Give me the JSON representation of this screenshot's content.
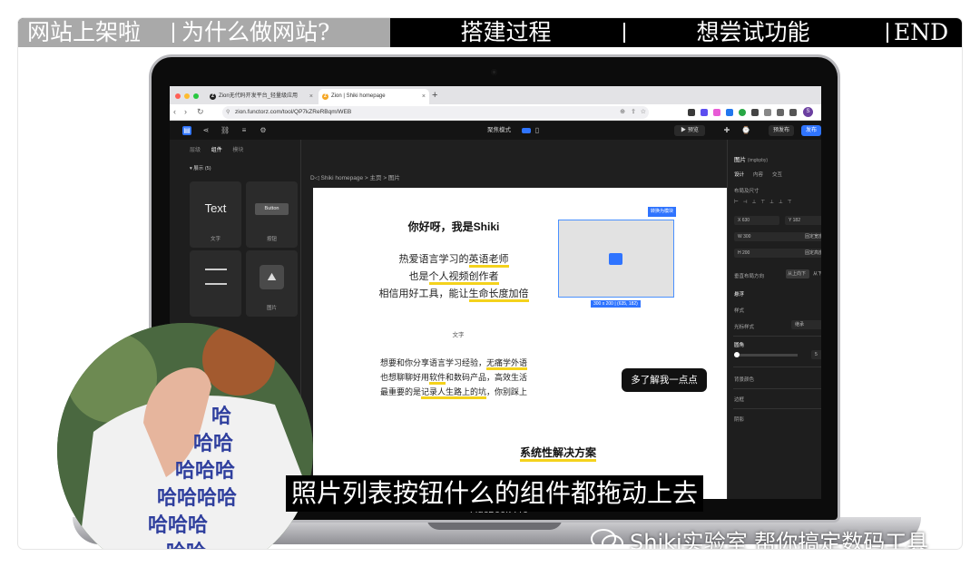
{
  "chapters": [
    {
      "label": "网站上架啦",
      "state": "done"
    },
    {
      "label": "为什么做网站?",
      "state": "done"
    },
    {
      "label": "搭建过程",
      "state": "current"
    },
    {
      "label": "想尝试功能",
      "state": "upcoming"
    },
    {
      "label": "END",
      "state": "upcoming"
    }
  ],
  "browser": {
    "tabs": [
      {
        "label": "Zion无代码开发平台_轻量级应用",
        "active": false
      },
      {
        "label": "Zion | Shiki homepage",
        "active": true
      }
    ],
    "url": "zion.functorz.com/tool/QP7kZReRBqm/WEB",
    "profile_initial": "S"
  },
  "editor": {
    "toolbar": {
      "mode_label": "聚焦模式",
      "preview_label": "预览",
      "prepublish_label": "预发布",
      "publish_label": "发布"
    },
    "left_panel": {
      "tabs": [
        "层级",
        "组件",
        "模块"
      ],
      "active_tab": "组件",
      "section": "展示 (5)",
      "components": [
        {
          "preview": "Text",
          "label": "文字"
        },
        {
          "preview": "Button",
          "label": "按钮"
        },
        {
          "preview": "",
          "label": ""
        },
        {
          "preview": "",
          "label": "图片"
        }
      ]
    },
    "breadcrumb": "Shiki homepage > 主页 > 图片",
    "canvas": {
      "title": "你好呀，我是Shiki",
      "intro_lines": [
        {
          "before": "热爱语言学习的",
          "highlight": "英语老师",
          "after": ""
        },
        {
          "before": "也是",
          "highlight": "个人视频创作者",
          "after": ""
        },
        {
          "before": "相信用好工具，能让",
          "highlight": "生命长度加倍",
          "after": ""
        }
      ],
      "small_label": "文字",
      "para_lines": [
        {
          "before": "想要和你分享语言学习经验，",
          "highlight": "无痛学外语",
          "after": ""
        },
        {
          "before": "也想聊聊好用",
          "highlight": "软件",
          "after": "和数码产品，高效生活"
        },
        {
          "before": "最重要的是",
          "highlight": "记录人生路上的坑",
          "after": "，你别踩上"
        }
      ],
      "image_badge": "转换为模块",
      "image_size": "300 x 200 | (635, 182)",
      "learn_more_button": "多了解我一点点",
      "section_heading": "系统性解决方案"
    },
    "right_panel": {
      "component_name": "图片",
      "component_id": "(imgbpby)",
      "tabs": [
        "设计",
        "内容",
        "交互"
      ],
      "fields": {
        "x": "630",
        "y": "182",
        "w": "300",
        "h": "200",
        "w_mode": "固定宽度",
        "h_mode": "固定高度"
      },
      "sections": [
        "布局及尺寸",
        "垂直布局方向",
        "悬浮",
        "样式",
        "光标样式",
        "圆角",
        "背景颜色",
        "边框",
        "阴影"
      ],
      "layout_options": [
        "从上向下",
        "从下向上"
      ],
      "cursor_value": "继承",
      "radius_value": "5"
    }
  },
  "laptop_model": "MacBook Pro",
  "subtitle": "照片列表按钮什么的组件都拖动上去",
  "watermark": "Shiki实验室 帮你搞定数码工具",
  "colors": {
    "accent": "#2f74ff",
    "highlight": "#f4d21c",
    "chapter_done": "#a9a9a9"
  }
}
